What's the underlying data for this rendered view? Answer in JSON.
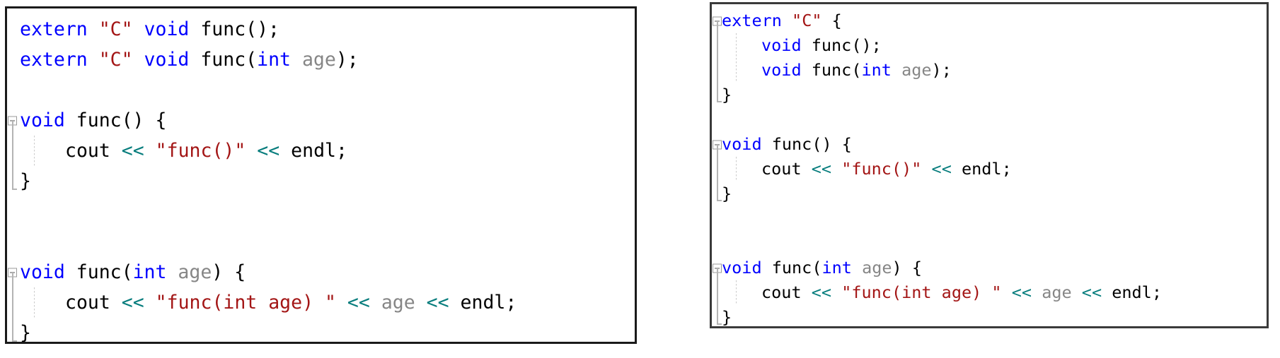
{
  "app": {
    "kind": "code-editor-comparison",
    "panel_count": 2
  },
  "colors": {
    "keyword": "#0000FF",
    "string": "#A31515",
    "operator": "#077D7D",
    "identifier": "#868686",
    "plain": "#000000",
    "background": "#FFFFFF",
    "panel_border": "#1A1A1A",
    "fold_guide": "#B4B4B4",
    "indent_guide": "#C9C9C9"
  },
  "left_panel": {
    "name": "code-panel-left",
    "language": "cpp",
    "lines": [
      {
        "n": 1,
        "indent": 0,
        "fold": "none",
        "rail": "none",
        "dots": false,
        "tokens": [
          {
            "t": "extern",
            "c": "kw"
          },
          {
            "t": " ",
            "c": "pl"
          },
          {
            "t": "\"C\"",
            "c": "str"
          },
          {
            "t": " ",
            "c": "pl"
          },
          {
            "t": "void",
            "c": "kw"
          },
          {
            "t": " func();",
            "c": "pl"
          }
        ]
      },
      {
        "n": 2,
        "indent": 0,
        "fold": "none",
        "rail": "none",
        "dots": false,
        "tokens": [
          {
            "t": "extern",
            "c": "kw"
          },
          {
            "t": " ",
            "c": "pl"
          },
          {
            "t": "\"C\"",
            "c": "str"
          },
          {
            "t": " ",
            "c": "pl"
          },
          {
            "t": "void",
            "c": "kw"
          },
          {
            "t": " func(",
            "c": "pl"
          },
          {
            "t": "int",
            "c": "kw"
          },
          {
            "t": " ",
            "c": "pl"
          },
          {
            "t": "age",
            "c": "id"
          },
          {
            "t": ");",
            "c": "pl"
          }
        ]
      },
      {
        "n": 3,
        "indent": 0,
        "fold": "none",
        "rail": "none",
        "dots": false,
        "tokens": []
      },
      {
        "n": 4,
        "indent": 0,
        "fold": "minus",
        "rail": "start",
        "dots": false,
        "tokens": [
          {
            "t": "void",
            "c": "kw"
          },
          {
            "t": " func() {",
            "c": "pl"
          }
        ]
      },
      {
        "n": 5,
        "indent": 1,
        "fold": "none",
        "rail": "mid",
        "dots": true,
        "tokens": [
          {
            "t": "cout ",
            "c": "pl"
          },
          {
            "t": "<<",
            "c": "op"
          },
          {
            "t": " ",
            "c": "pl"
          },
          {
            "t": "\"func()\"",
            "c": "str"
          },
          {
            "t": " ",
            "c": "pl"
          },
          {
            "t": "<<",
            "c": "op"
          },
          {
            "t": " endl;",
            "c": "pl"
          }
        ]
      },
      {
        "n": 6,
        "indent": 0,
        "fold": "none",
        "rail": "end",
        "dots": false,
        "tokens": [
          {
            "t": "}",
            "c": "pl"
          }
        ]
      },
      {
        "n": 7,
        "indent": 0,
        "fold": "none",
        "rail": "none",
        "dots": false,
        "tokens": []
      },
      {
        "n": 8,
        "indent": 0,
        "fold": "none",
        "rail": "none",
        "dots": false,
        "tokens": []
      },
      {
        "n": 9,
        "indent": 0,
        "fold": "minus",
        "rail": "start",
        "dots": false,
        "tokens": [
          {
            "t": "void",
            "c": "kw"
          },
          {
            "t": " func(",
            "c": "pl"
          },
          {
            "t": "int",
            "c": "kw"
          },
          {
            "t": " ",
            "c": "pl"
          },
          {
            "t": "age",
            "c": "id"
          },
          {
            "t": ") {",
            "c": "pl"
          }
        ]
      },
      {
        "n": 10,
        "indent": 1,
        "fold": "none",
        "rail": "mid",
        "dots": true,
        "tokens": [
          {
            "t": "cout ",
            "c": "pl"
          },
          {
            "t": "<<",
            "c": "op"
          },
          {
            "t": " ",
            "c": "pl"
          },
          {
            "t": "\"func(int age) \"",
            "c": "str"
          },
          {
            "t": " ",
            "c": "pl"
          },
          {
            "t": "<<",
            "c": "op"
          },
          {
            "t": " ",
            "c": "pl"
          },
          {
            "t": "age",
            "c": "id"
          },
          {
            "t": " ",
            "c": "pl"
          },
          {
            "t": "<<",
            "c": "op"
          },
          {
            "t": " endl;",
            "c": "pl"
          }
        ]
      },
      {
        "n": 11,
        "indent": 0,
        "fold": "none",
        "rail": "end",
        "dots": false,
        "tokens": [
          {
            "t": "}",
            "c": "pl"
          }
        ]
      }
    ]
  },
  "right_panel": {
    "name": "code-panel-right",
    "language": "cpp",
    "lines": [
      {
        "n": 1,
        "indent": 0,
        "fold": "minus",
        "rail": "start",
        "dots": false,
        "tokens": [
          {
            "t": "extern",
            "c": "kw"
          },
          {
            "t": " ",
            "c": "pl"
          },
          {
            "t": "\"C\"",
            "c": "str"
          },
          {
            "t": " {",
            "c": "pl"
          }
        ]
      },
      {
        "n": 2,
        "indent": 1,
        "fold": "none",
        "rail": "mid",
        "dots": true,
        "tokens": [
          {
            "t": "void",
            "c": "kw"
          },
          {
            "t": " func();",
            "c": "pl"
          }
        ]
      },
      {
        "n": 3,
        "indent": 1,
        "fold": "none",
        "rail": "mid",
        "dots": true,
        "tokens": [
          {
            "t": "void",
            "c": "kw"
          },
          {
            "t": " func(",
            "c": "pl"
          },
          {
            "t": "int",
            "c": "kw"
          },
          {
            "t": " ",
            "c": "pl"
          },
          {
            "t": "age",
            "c": "id"
          },
          {
            "t": ");",
            "c": "pl"
          }
        ]
      },
      {
        "n": 4,
        "indent": 0,
        "fold": "none",
        "rail": "end",
        "dots": false,
        "tokens": [
          {
            "t": "}",
            "c": "pl"
          }
        ]
      },
      {
        "n": 5,
        "indent": 0,
        "fold": "none",
        "rail": "none",
        "dots": false,
        "tokens": []
      },
      {
        "n": 6,
        "indent": 0,
        "fold": "minus",
        "rail": "start",
        "dots": false,
        "tokens": [
          {
            "t": "void",
            "c": "kw"
          },
          {
            "t": " func() {",
            "c": "pl"
          }
        ]
      },
      {
        "n": 7,
        "indent": 1,
        "fold": "none",
        "rail": "mid",
        "dots": true,
        "tokens": [
          {
            "t": "cout ",
            "c": "pl"
          },
          {
            "t": "<<",
            "c": "op"
          },
          {
            "t": " ",
            "c": "pl"
          },
          {
            "t": "\"func()\"",
            "c": "str"
          },
          {
            "t": " ",
            "c": "pl"
          },
          {
            "t": "<<",
            "c": "op"
          },
          {
            "t": " endl;",
            "c": "pl"
          }
        ]
      },
      {
        "n": 8,
        "indent": 0,
        "fold": "none",
        "rail": "end",
        "dots": false,
        "tokens": [
          {
            "t": "}",
            "c": "pl"
          }
        ]
      },
      {
        "n": 9,
        "indent": 0,
        "fold": "none",
        "rail": "none",
        "dots": false,
        "tokens": []
      },
      {
        "n": 10,
        "indent": 0,
        "fold": "none",
        "rail": "none",
        "dots": false,
        "tokens": []
      },
      {
        "n": 11,
        "indent": 0,
        "fold": "minus",
        "rail": "start",
        "dots": false,
        "tokens": [
          {
            "t": "void",
            "c": "kw"
          },
          {
            "t": " func(",
            "c": "pl"
          },
          {
            "t": "int",
            "c": "kw"
          },
          {
            "t": " ",
            "c": "pl"
          },
          {
            "t": "age",
            "c": "id"
          },
          {
            "t": ") {",
            "c": "pl"
          }
        ]
      },
      {
        "n": 12,
        "indent": 1,
        "fold": "none",
        "rail": "mid",
        "dots": true,
        "tokens": [
          {
            "t": "cout ",
            "c": "pl"
          },
          {
            "t": "<<",
            "c": "op"
          },
          {
            "t": " ",
            "c": "pl"
          },
          {
            "t": "\"func(int age) \"",
            "c": "str"
          },
          {
            "t": " ",
            "c": "pl"
          },
          {
            "t": "<<",
            "c": "op"
          },
          {
            "t": " ",
            "c": "pl"
          },
          {
            "t": "age",
            "c": "id"
          },
          {
            "t": " ",
            "c": "pl"
          },
          {
            "t": "<<",
            "c": "op"
          },
          {
            "t": " endl;",
            "c": "pl"
          }
        ]
      },
      {
        "n": 13,
        "indent": 0,
        "fold": "none",
        "rail": "end",
        "dots": false,
        "tokens": [
          {
            "t": "}",
            "c": "pl"
          }
        ]
      }
    ]
  }
}
